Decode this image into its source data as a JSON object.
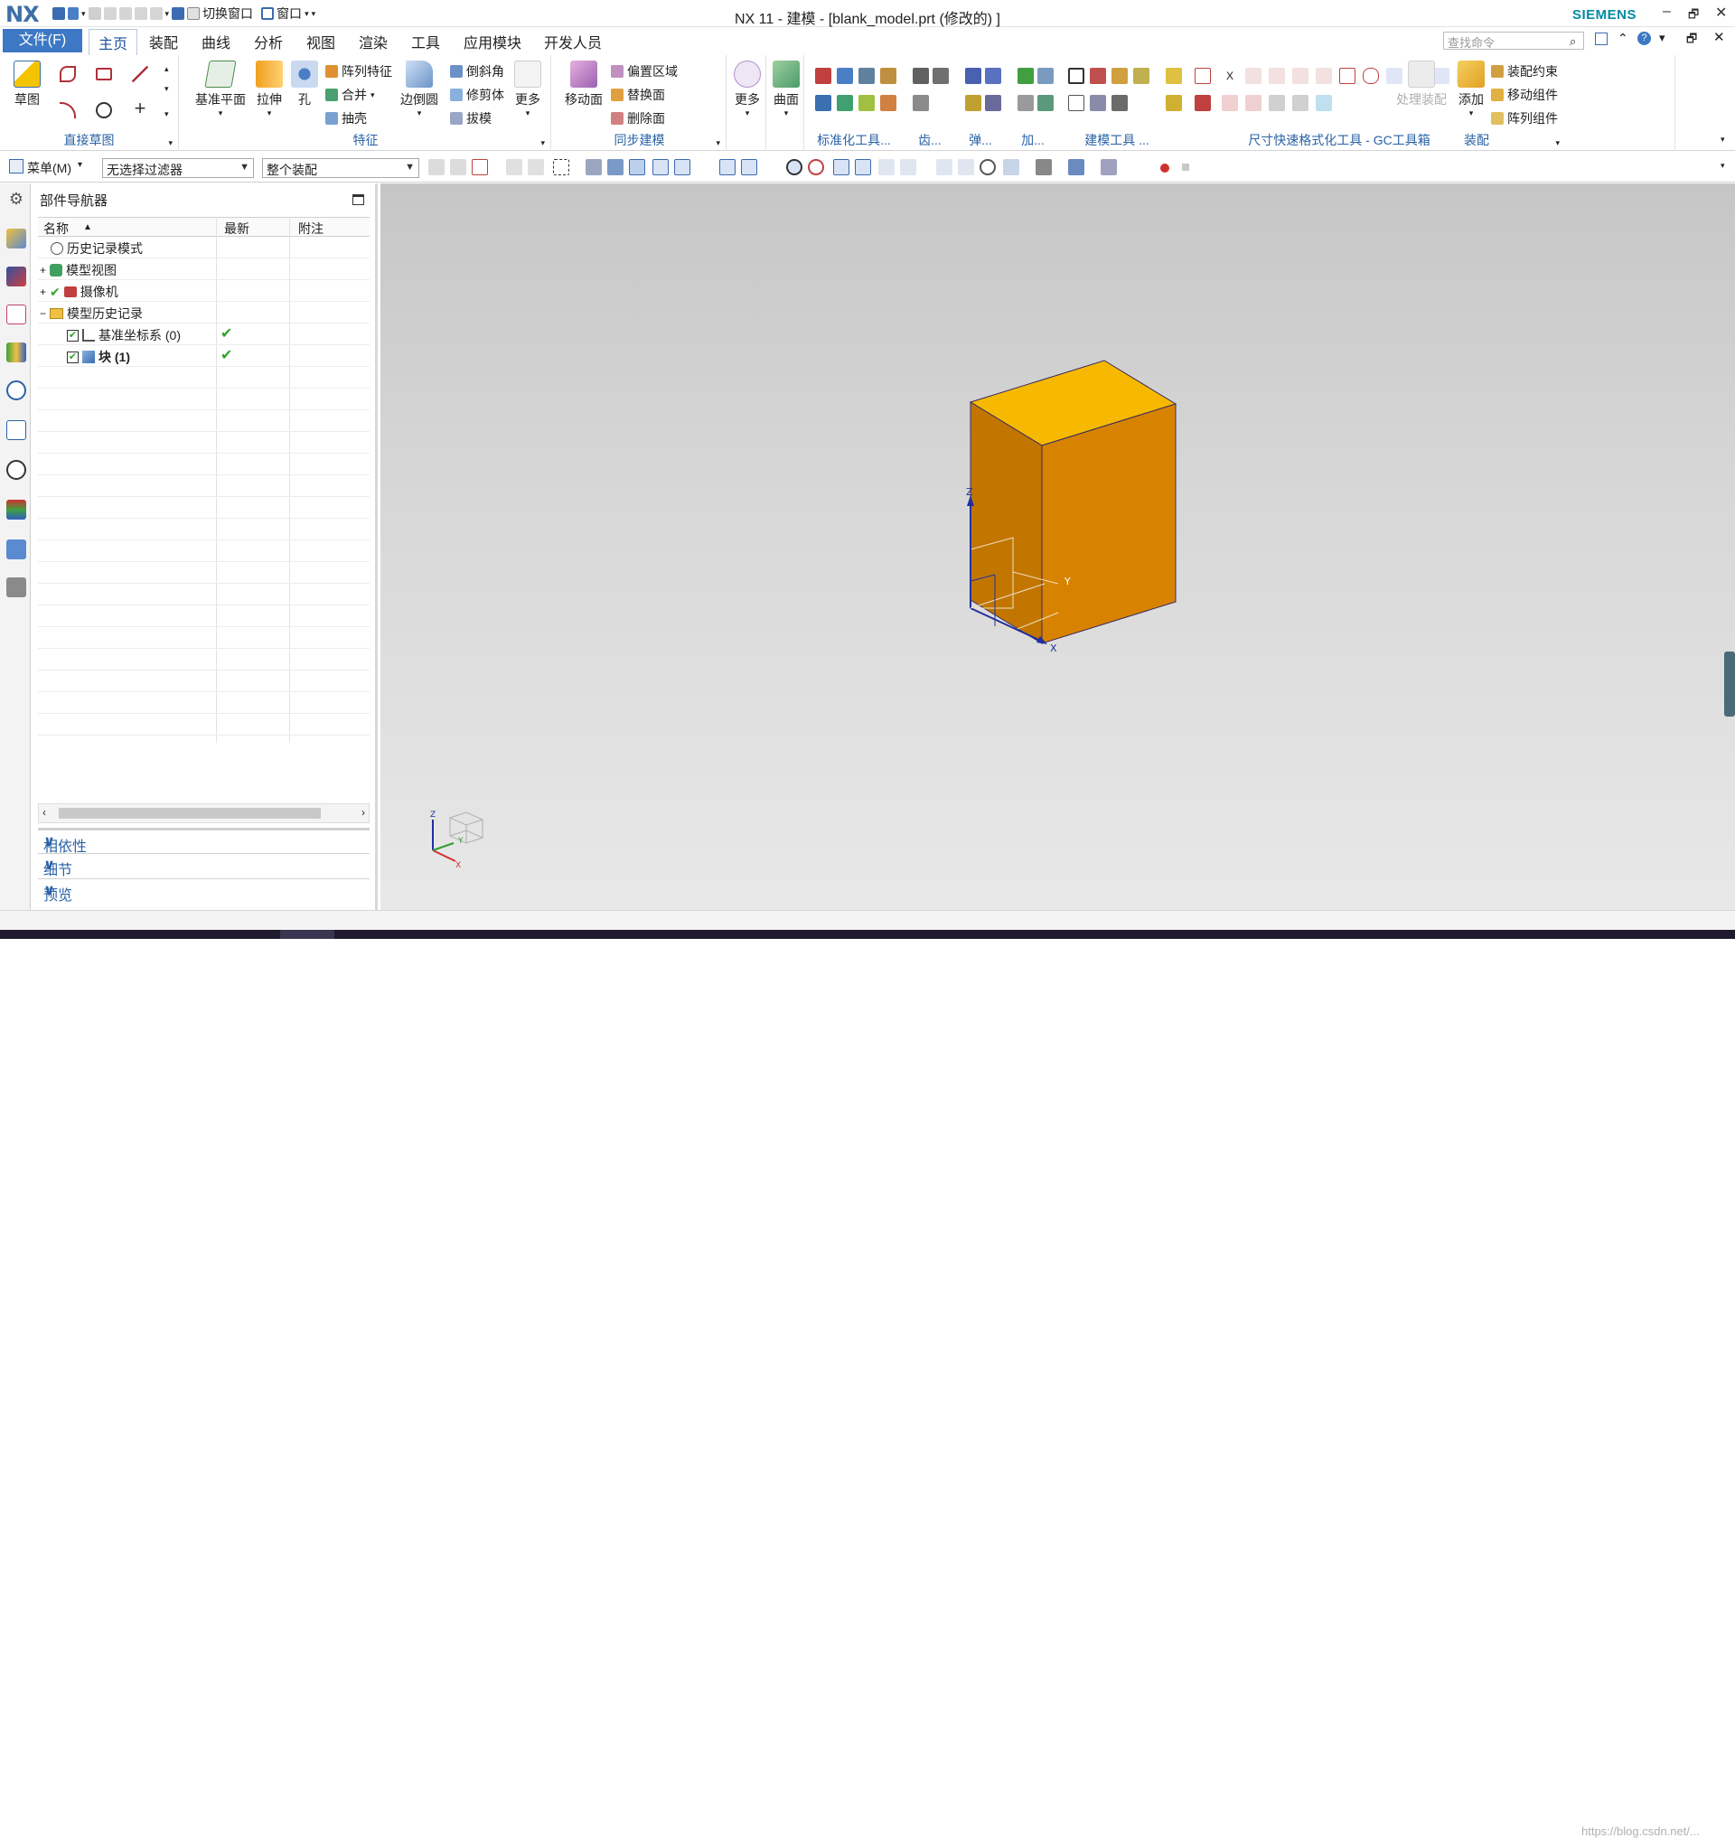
{
  "window": {
    "logo": "NX",
    "title": "NX 11 - 建模 - [blank_model.prt  (修改的) ]",
    "quick_switch": "切换窗口",
    "quick_window": "窗口",
    "brand": "SIEMENS",
    "minimize": "–",
    "restore": "🗗",
    "close": "✕"
  },
  "menubar": {
    "file": "文件(F)",
    "tabs": [
      "主页",
      "装配",
      "曲线",
      "分析",
      "视图",
      "渲染",
      "工具",
      "应用模块",
      "开发人员"
    ],
    "active_tab": "主页",
    "search_placeholder": "查找命令"
  },
  "ribbon": {
    "sketch": {
      "label": "草图",
      "group": "直接草图"
    },
    "feature": {
      "datum_plane": "基准平面",
      "extrude": "拉伸",
      "hole": "孔",
      "pattern": "阵列特征",
      "unite": "合并",
      "shell": "抽壳",
      "edge_blend": "边倒圆",
      "chamfer": "倒斜角",
      "trim_body": "修剪体",
      "draft": "拔模",
      "more": "更多",
      "group": "特征"
    },
    "sync": {
      "move_face": "移动面",
      "offset_region": "偏置区域",
      "replace_face": "替换面",
      "delete_face": "删除面",
      "more": "更多",
      "group": "同步建模"
    },
    "surface": {
      "label": "曲面"
    },
    "small_groups": [
      "标准化工具...",
      "齿...",
      "弹...",
      "加...",
      "建模工具 ...",
      "尺寸快速格式化工具 - GC工具箱"
    ],
    "assembly": {
      "process": "处理装配",
      "add": "添加",
      "constraint": "装配约束",
      "move_comp": "移动组件",
      "pattern_comp": "阵列组件",
      "group": "装配"
    }
  },
  "toolbar2": {
    "menu": "菜单(M)",
    "filter": "无选择过滤器",
    "scope": "整个装配"
  },
  "navigator": {
    "title": "部件导航器",
    "columns": [
      "名称",
      "最新",
      "附注"
    ],
    "rows": [
      {
        "name": "历史记录模式",
        "latest": ""
      },
      {
        "name": "模型视图",
        "latest": ""
      },
      {
        "name": "摄像机",
        "latest": ""
      },
      {
        "name": "模型历史记录",
        "latest": ""
      },
      {
        "name": "基准坐标系 (0)",
        "latest": "✔"
      },
      {
        "name": "块 (1)",
        "latest": "✔"
      }
    ],
    "panels": [
      "相依性",
      "细节",
      "预览"
    ]
  },
  "viewport": {
    "axis_x": "X",
    "axis_y": "Y",
    "axis_z": "Z",
    "triad_x": "X",
    "triad_y": "Y",
    "triad_z": "Z"
  },
  "status": {
    "watermark": "https://blog.csdn.net/..."
  },
  "colors": {
    "accent": "#3c78c4",
    "box_top": "#f5b800",
    "box_front": "#c87a00",
    "box_side": "#d88400"
  }
}
